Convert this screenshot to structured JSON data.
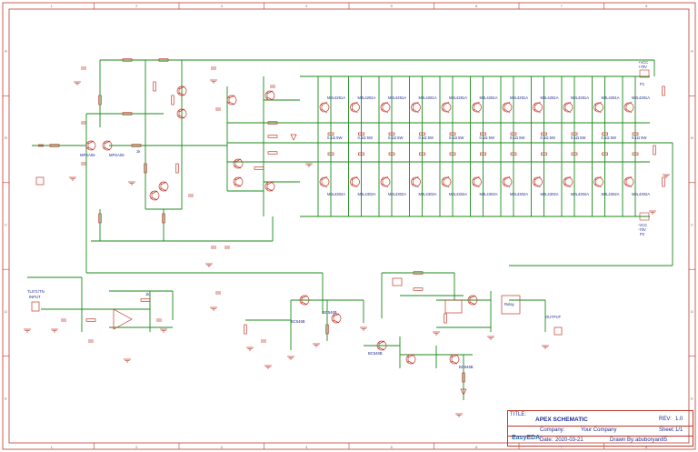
{
  "frame": {
    "columns": [
      "1",
      "2",
      "3",
      "4",
      "5",
      "6",
      "7",
      "8"
    ],
    "rows": [
      "A",
      "B",
      "C",
      "D",
      "E"
    ]
  },
  "power": {
    "vcc_pos": "+VCC",
    "vcc_pos_note": "+70V",
    "vcc_neg": "-VCC",
    "vcc_neg_note": "-70V",
    "p1": "P1",
    "p2": "P2",
    "gnd": "GND"
  },
  "labels": {
    "input": "INPUT",
    "output": "OUTPUT",
    "tl071": "TL071/TN",
    "relay": "Relay",
    "mje": "MJL4281A",
    "mjl_neg": "MJL4302A",
    "q_bc": "BC546B",
    "q_mps": "MPSA06",
    "res_5w": "0.1Ω 5W",
    "res_1k": "1k"
  },
  "title_block": {
    "title_label": "TITLE:",
    "title": "APEX SCHEMATIC",
    "rev_label": "REV:",
    "rev": "1.0",
    "company_label": "Company:",
    "company": "Your Company",
    "sheet_label": "Sheet:",
    "sheet": "1/1",
    "date_label": "Date:",
    "date": "2020-03-21",
    "drawn_label": "Drawn By:",
    "drawn": "abuboryan85",
    "brand": "EasyEDA"
  },
  "colors": {
    "wire": "#1a8a1a",
    "component": "#c0392b",
    "text": "#1f2d8f",
    "frame": "#c0392b"
  }
}
